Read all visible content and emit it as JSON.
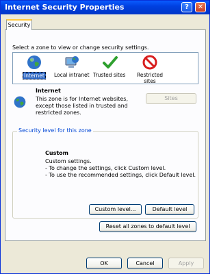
{
  "window": {
    "title": "Internet Security Properties",
    "help_glyph": "?",
    "close_glyph": "✕"
  },
  "tabs": [
    {
      "label": "Security"
    }
  ],
  "zone_prompt": "Select a zone to view or change security settings.",
  "zones": [
    {
      "label": "Internet",
      "icon": "globe-icon",
      "selected": true
    },
    {
      "label": "Local intranet",
      "icon": "computer-globe-icon",
      "selected": false
    },
    {
      "label": "Trusted sites",
      "icon": "checkmark-icon",
      "selected": false
    },
    {
      "label": "Restricted sites",
      "label_line1": "Restricted",
      "label_line2": "sites",
      "icon": "no-entry-icon",
      "selected": false
    }
  ],
  "zone_info": {
    "title": "Internet",
    "line1": "This zone is for Internet websites,",
    "line2": "except those listed in trusted and",
    "line3": "restricted zones.",
    "sites_button": "Sites"
  },
  "security_level": {
    "group_title": "Security level for this zone",
    "level_title": "Custom",
    "desc1": "Custom settings.",
    "desc2": "- To change the settings, click Custom level.",
    "desc3": "- To use the recommended settings, click Default level.",
    "custom_button": "Custom level...",
    "default_button": "Default level"
  },
  "reset_button": "Reset all zones to default level",
  "footer": {
    "ok": "OK",
    "cancel": "Cancel",
    "apply": "Apply"
  },
  "colors": {
    "titlebar": "#0040e0",
    "selection": "#316ac5",
    "group_title": "#0046d5"
  }
}
